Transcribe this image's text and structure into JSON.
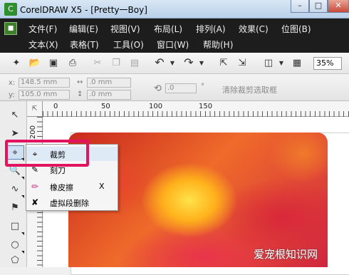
{
  "window": {
    "title": "CorelDRAW X5 - [Pretty一Boy]",
    "min_label": "–",
    "max_label": "□",
    "close_label": "✕"
  },
  "menubar": {
    "row1": [
      "文件(F)",
      "编辑(E)",
      "视图(V)",
      "布局(L)",
      "排列(A)",
      "效果(C)",
      "位图(B)"
    ],
    "row2": [
      "文本(X)",
      "表格(T)",
      "工具(O)",
      "窗口(W)",
      "帮助(H)"
    ]
  },
  "toolbar": {
    "zoom": "35%"
  },
  "propertybar": {
    "x_label": "x:",
    "x_value": "148.5 mm",
    "y_label": "y:",
    "y_value": "105.0 mm",
    "w_value": ".0 mm",
    "h_value": ".0 mm",
    "rotate_value": ".0",
    "degree": "°",
    "clear_crop_label": "清除裁剪选取框"
  },
  "ruler": {
    "h_ticks": [
      "0",
      "50",
      "100",
      "150"
    ],
    "v_ticks": [
      "200",
      "150"
    ]
  },
  "context_menu": {
    "items": [
      {
        "label": "裁剪",
        "shortcut": ""
      },
      {
        "label": "刻刀",
        "shortcut": ""
      },
      {
        "label": "橡皮擦",
        "shortcut": "X"
      },
      {
        "label": "虚拟段删除",
        "shortcut": ""
      }
    ]
  },
  "watermark": "爱宠根知识网",
  "colors": {
    "highlight_border": "#e2145f",
    "menubar_bg": "#1d1d1d"
  }
}
